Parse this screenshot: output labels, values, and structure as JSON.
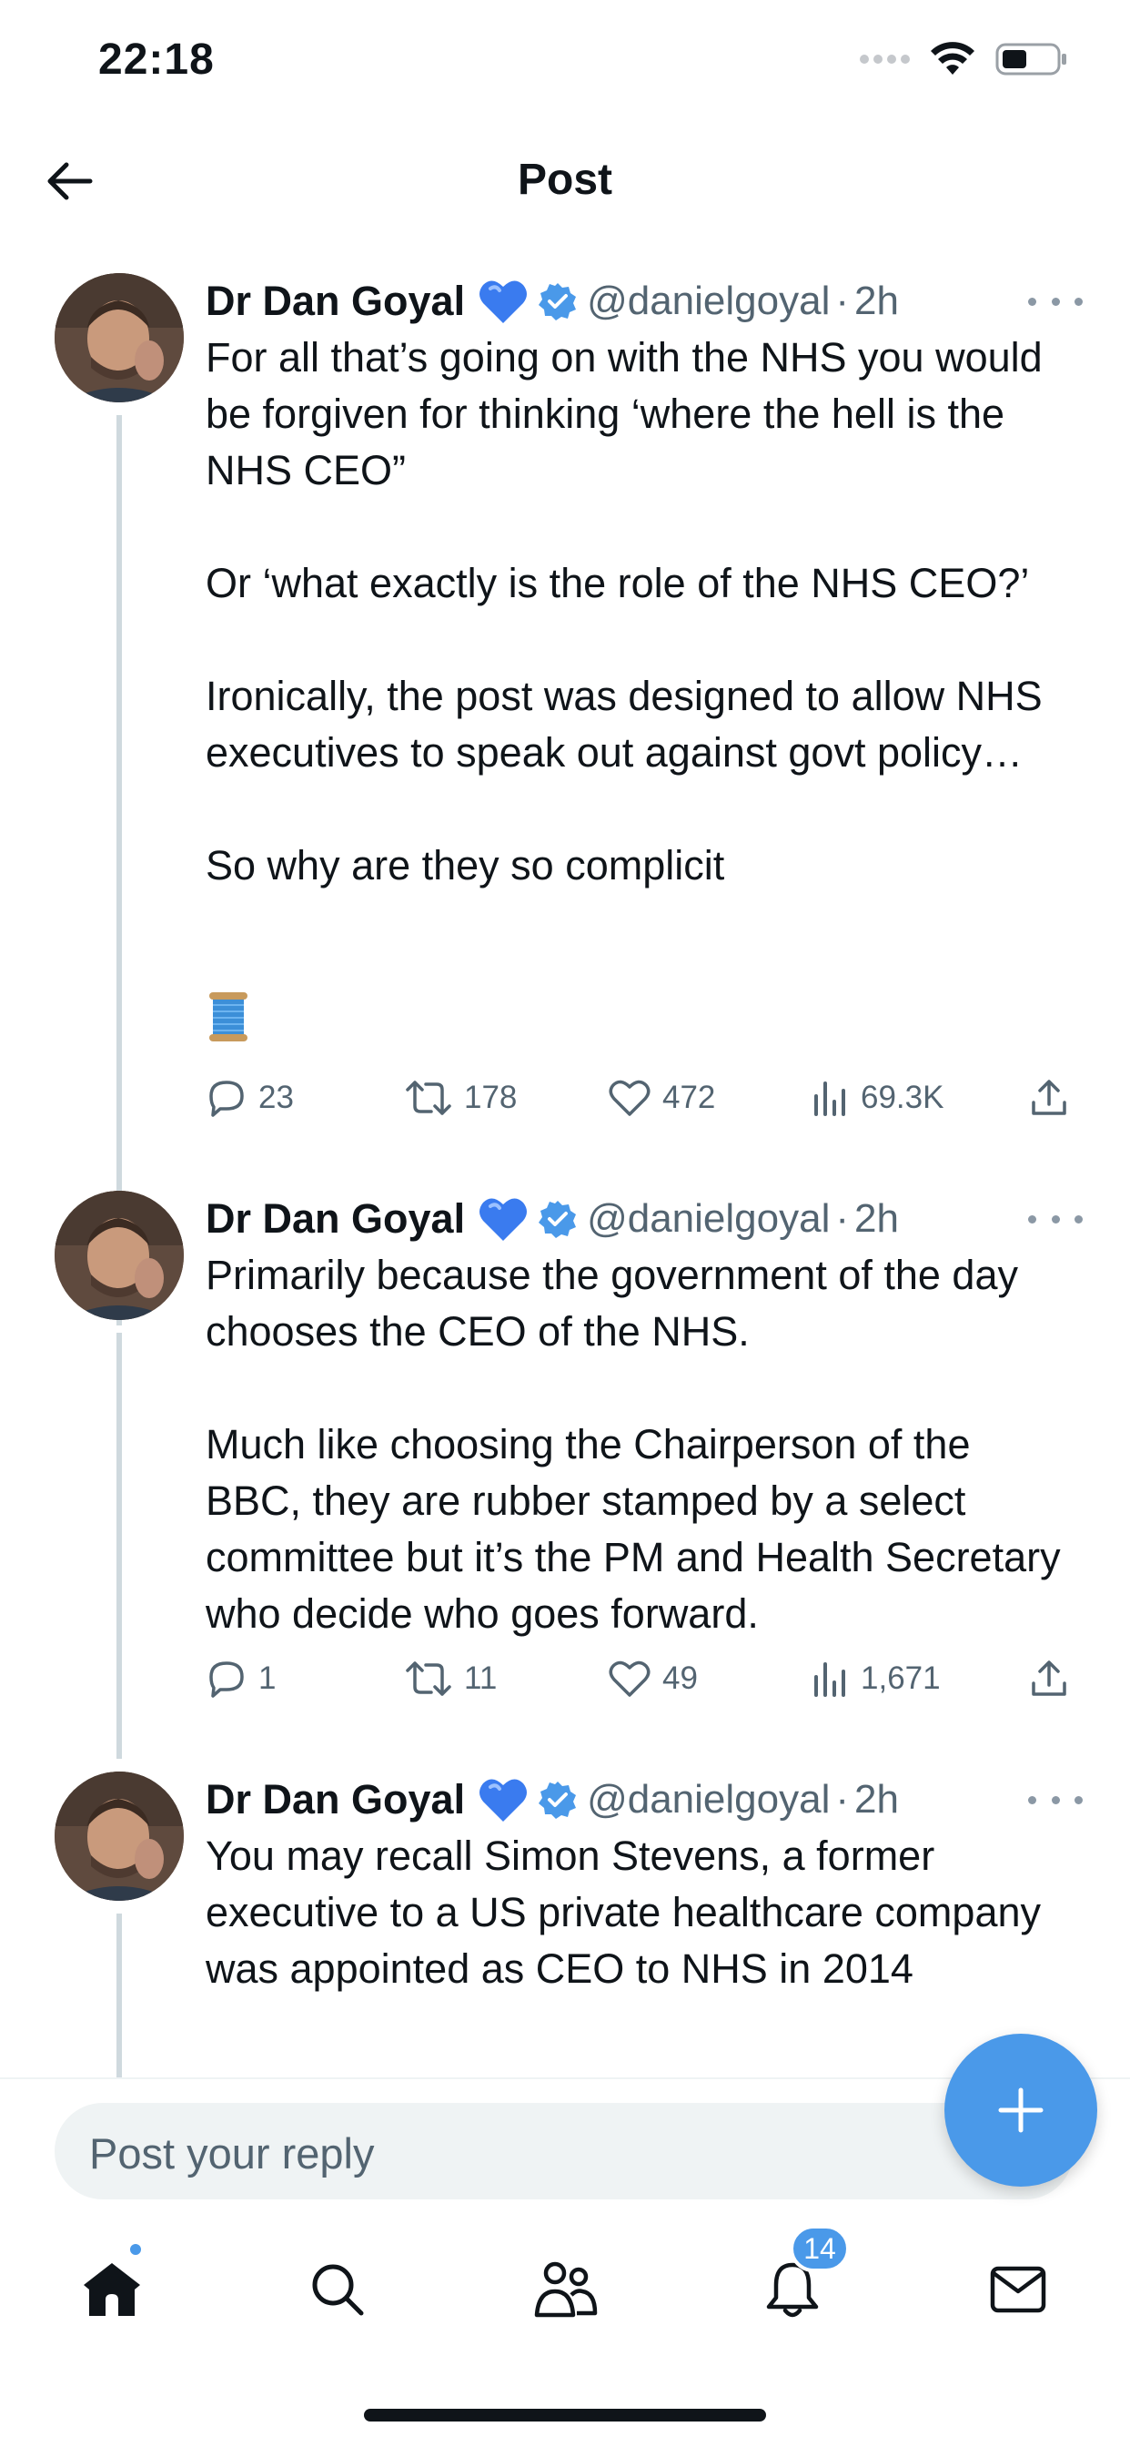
{
  "status_bar": {
    "time": "22:18"
  },
  "header": {
    "title": "Post"
  },
  "tweets": [
    {
      "name": "Dr Dan Goyal",
      "handle": "@danielgoyal",
      "separator": "·",
      "time": "2h",
      "text": "For all that’s going on with the NHS you would be forgiven for thinking ‘where the hell is the NHS CEO”\n\nOr ‘what exactly is the role of the NHS CEO?’\n\nIronically, the post was designed to allow NHS executives to speak out against govt policy…\n\nSo why are they so complicit",
      "thread_emoji": "thread-spool-emoji",
      "replies": "23",
      "reposts": "178",
      "likes": "472",
      "views": "69.3K"
    },
    {
      "name": "Dr Dan Goyal",
      "handle": "@danielgoyal",
      "separator": "·",
      "time": "2h",
      "text": "Primarily because the government of the day chooses the CEO of the NHS.\n\nMuch like choosing the Chairperson of the BBC, they are rubber stamped by a select committee but it’s the PM and Health Secretary who decide who goes forward.",
      "replies": "1",
      "reposts": "11",
      "likes": "49",
      "views": "1,671"
    },
    {
      "name": "Dr Dan Goyal",
      "handle": "@danielgoyal",
      "separator": "·",
      "time": "2h",
      "text": "You may recall Simon Stevens, a former executive to a US private healthcare company was appointed as CEO to NHS in 2014"
    }
  ],
  "reply": {
    "placeholder": "Post your reply"
  },
  "tabbar": {
    "notifications_count": "14"
  },
  "colors": {
    "accent": "#4a99e9",
    "text": "#0f1419",
    "secondary": "#536471",
    "thread_line": "#cfd9de"
  },
  "icons": [
    "back-arrow-icon",
    "blue-heart-icon",
    "verified-badge-icon",
    "reply-icon",
    "repost-icon",
    "like-icon",
    "views-icon",
    "share-icon",
    "compose-plus-icon",
    "home-icon",
    "search-icon",
    "communities-icon",
    "bell-icon",
    "mail-icon"
  ]
}
